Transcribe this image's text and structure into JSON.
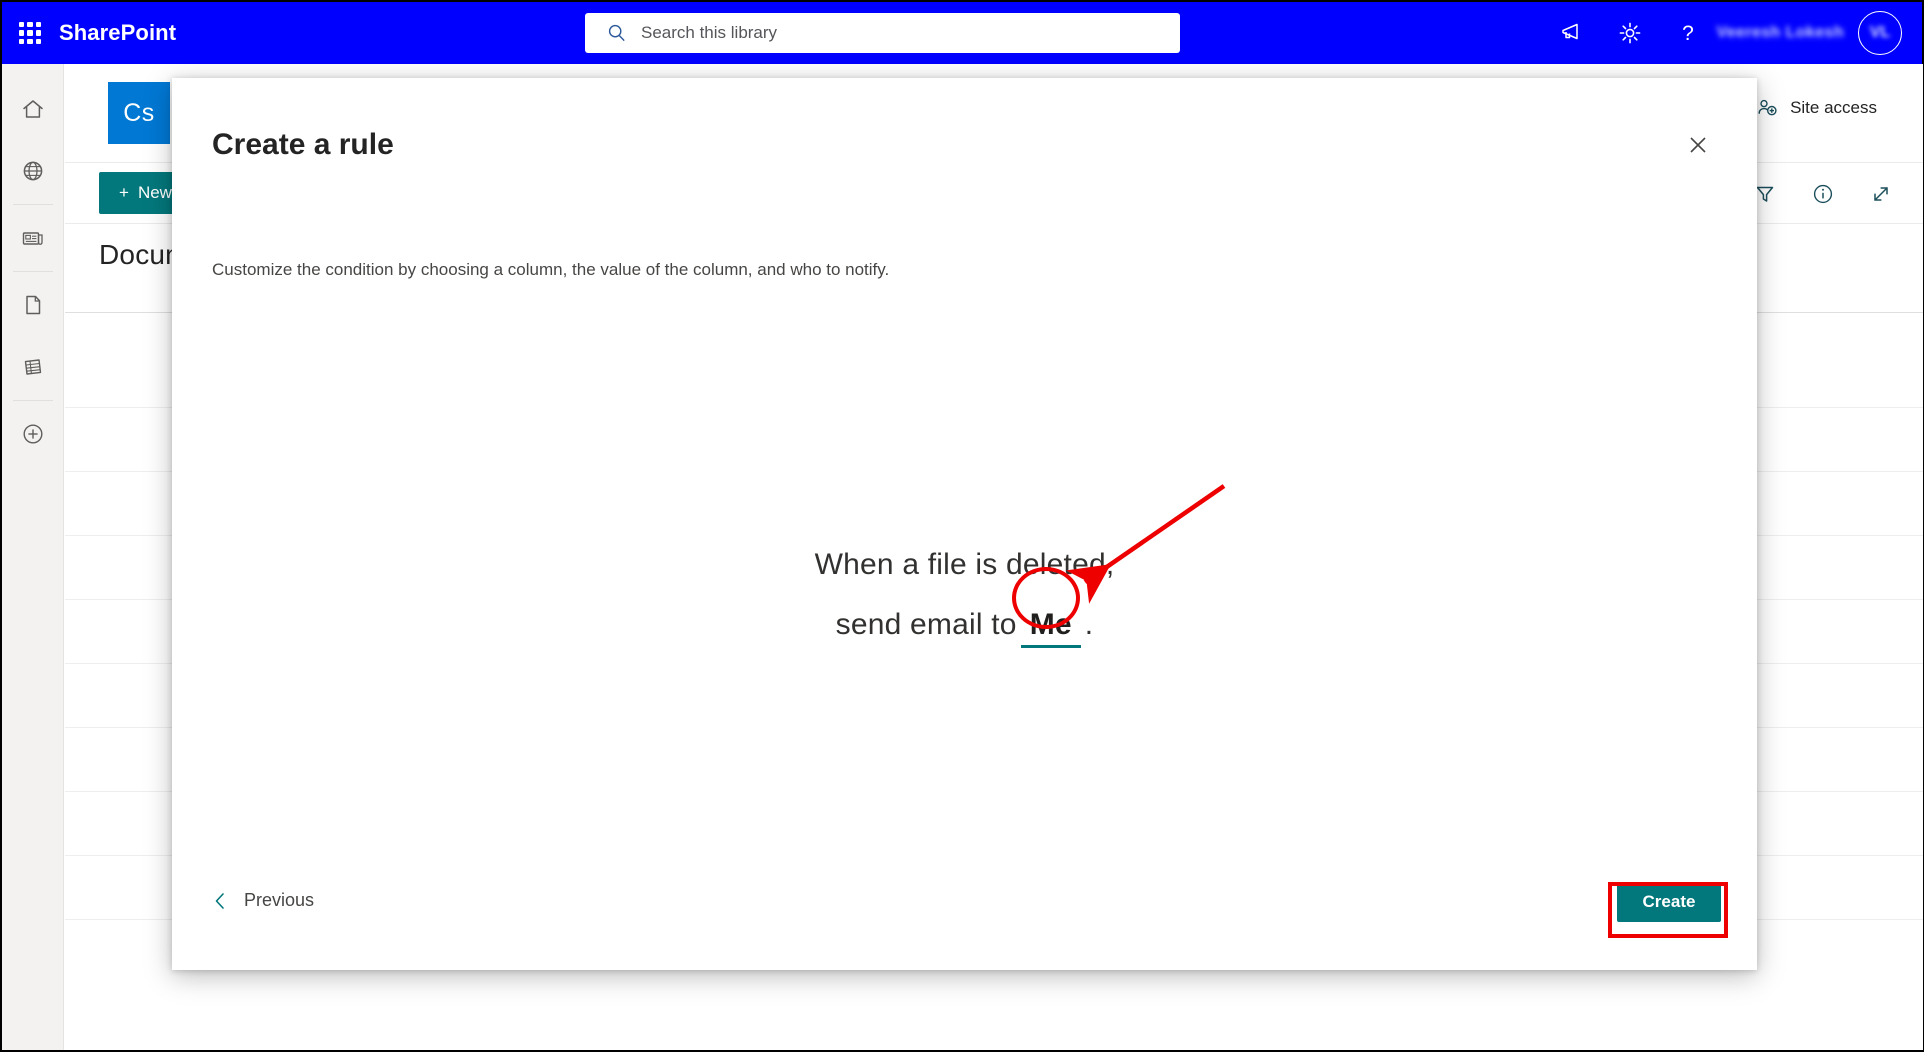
{
  "suitebar": {
    "waffle_label": "App launcher",
    "brand": "SharePoint",
    "search_placeholder": "Search this library",
    "search_value": "",
    "icons": [
      "megaphone-icon",
      "gear-icon",
      "help-icon"
    ],
    "user_name": "Veeresh Lokesh",
    "avatar_initials": "VL",
    "background_color": "#0000ff"
  },
  "rail": {
    "items": [
      {
        "name": "home",
        "icon": "home-icon"
      },
      {
        "name": "my-sites",
        "icon": "globe-icon"
      },
      {
        "name": "news",
        "icon": "news-icon"
      },
      {
        "name": "pages",
        "icon": "page-icon"
      },
      {
        "name": "lists",
        "icon": "list-icon"
      },
      {
        "name": "create",
        "icon": "plus-circle-icon"
      }
    ]
  },
  "site": {
    "logo_text": "Cs",
    "logo_color": "#0078d4",
    "site_access_label": "Site access",
    "new_button_label": "New",
    "library_title": "Documents",
    "command_icons": [
      "filter-icon",
      "info-icon",
      "expand-icon"
    ],
    "row_count": 9
  },
  "modal": {
    "title": "Create a rule",
    "subtitle": "Customize the condition by choosing a column, the value of the column, and who to notify.",
    "close_label": "Close",
    "rule": {
      "line1": "When a file is deleted,",
      "line2_prefix": "send email to",
      "recipient_token": "Me",
      "line2_suffix": "."
    },
    "previous_label": "Previous",
    "create_label": "Create",
    "accent_color": "#03787c"
  },
  "annotations": {
    "circle_target": "Me",
    "rect_target": "Create",
    "color": "#ee0000"
  }
}
